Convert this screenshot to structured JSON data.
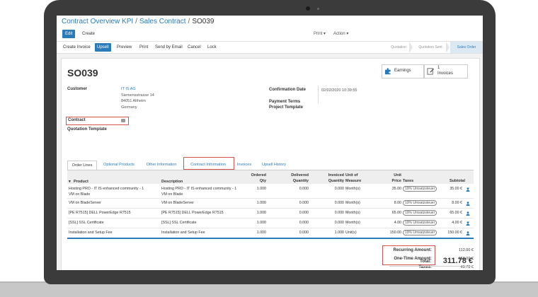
{
  "breadcrumb": {
    "item1": "Contract Overview KPI",
    "item2": "Sales Contract",
    "current": "SO039",
    "separator": "/"
  },
  "control": {
    "edit": "Edit",
    "create": "Create",
    "print": "Print ▾",
    "action": "Action ▾"
  },
  "toolbar": {
    "create_invoice": "Create Invoice",
    "upsell": "Upsell",
    "preview": "Preview",
    "print": "Print",
    "send_by_email": "Send by Email",
    "cancel": "Cancel",
    "lock": "Lock"
  },
  "stages": [
    "Quotation",
    "Quotation Sent",
    "Sales Order"
  ],
  "order": {
    "name": "SO039"
  },
  "smart_buttons": {
    "earnings": "Earnings",
    "invoices_count": "1",
    "invoices_label": "Invoices"
  },
  "customer": {
    "label": "Customer",
    "name": "IT IS AG",
    "street": "Siemensstrasse 14",
    "city": "84051 Altheim",
    "country": "Germany"
  },
  "fields": {
    "confirmation_date_label": "Confirmation Date",
    "confirmation_date": "02/02/2020 10:39:55",
    "payment_terms_label": "Payment Terms",
    "project_template_label": "Project Template",
    "contract_label": "Contract",
    "quotation_template_label": "Quotation Template"
  },
  "tabs": [
    "Order Lines",
    "Optional Products",
    "Other Information",
    "Contract Information",
    "Invoices",
    "Upsell History"
  ],
  "columns": {
    "product": "Product",
    "description": "Description",
    "ordered_1": "Ordered",
    "ordered_2": "Qty",
    "delivered_1": "Delivered",
    "delivered_2": "Quantity",
    "invoiced_1": "Invoiced",
    "invoiced_2": "Quantity",
    "unit_1": "Unit of",
    "unit_2": "Measure",
    "price_1": "Unit",
    "price_2": "Price",
    "taxes": "Taxes",
    "subtotal": "Subtotal"
  },
  "lines": [
    {
      "product_1": "Hosting PRO - IT IS enhanced community - 1",
      "product_2": "VM on Blade",
      "desc_1": "Hosting PRO - IT IS enhanced community - 1",
      "desc_2": "VM on Blade",
      "qty": "1.000",
      "delivered": "0.000",
      "invoiced": "0.000",
      "uom": "Month(s)",
      "price": "35.00",
      "tax": "19% Umsatzsteuer",
      "subtotal": "35.00 €"
    },
    {
      "product_1": "VM on BladeServer",
      "product_2": "",
      "desc_1": "VM on BladeServer",
      "desc_2": "",
      "qty": "1.000",
      "delivered": "0.000",
      "invoiced": "0.000",
      "uom": "Month(s)",
      "price": "8.00",
      "tax": "19% Umsatzsteuer",
      "subtotal": "8.00 €"
    },
    {
      "product_1": "[PE R7515] DELL PowerEdge R7515",
      "product_2": "",
      "desc_1": "[PE R7515] DELL PowerEdge R7515",
      "desc_2": "",
      "qty": "1.000",
      "delivered": "0.000",
      "invoiced": "0.000",
      "uom": "Month(s)",
      "price": "65.00",
      "tax": "19% Umsatzsteuer",
      "subtotal": "65.00 €"
    },
    {
      "product_1": "[SSL] SSL Certificate",
      "product_2": "",
      "desc_1": "[SSL] SSL Certificate",
      "desc_2": "",
      "qty": "1.000",
      "delivered": "0.000",
      "invoiced": "0.000",
      "uom": "Month(s)",
      "price": "4.00",
      "tax": "19% Umsatzsteuer",
      "subtotal": "4.00 €"
    },
    {
      "product_1": "Installation and Setup Fee",
      "product_2": "",
      "desc_1": "Installation and Setup Fee",
      "desc_2": "",
      "qty": "1.000",
      "delivered": "0.000",
      "invoiced": "1.000",
      "uom": "Unit(s)",
      "price": "150.00",
      "tax": "19% Umsatzsteuer",
      "subtotal": "150.00 €"
    }
  ],
  "totals": {
    "recurring_label": "Recurring Amount:",
    "recurring": "112.00 €",
    "one_time_label": "One-Time Amount:",
    "one_time": "150.00 €",
    "taxes_label": "Taxes:",
    "taxes": "49.78 €",
    "total_label": "Total:",
    "total": "311.78 €"
  },
  "colors": {
    "accent": "#2b7bb9",
    "highlight": "#d9534f"
  }
}
